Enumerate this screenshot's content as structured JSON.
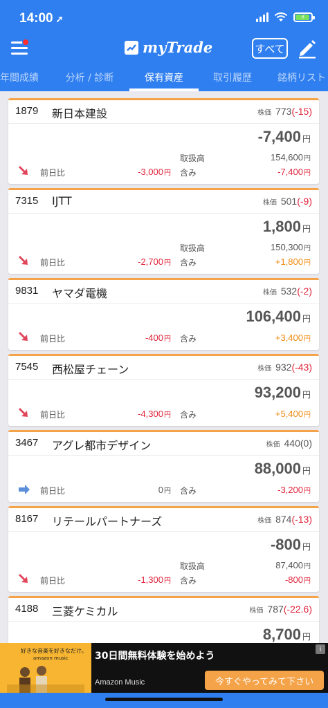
{
  "status": {
    "time": "14:00"
  },
  "header": {
    "logo": "myTrade",
    "all_button": "すべて"
  },
  "tabs": [
    {
      "label": "年間成績"
    },
    {
      "label": "分析 / 診断"
    },
    {
      "label": "保有資産"
    },
    {
      "label": "取引履歴"
    },
    {
      "label": "銘柄リスト"
    }
  ],
  "active_tab": 2,
  "labels": {
    "price": "株価",
    "day_change": "前日比",
    "turnover": "取扱高",
    "incl": "含み",
    "yen": "円"
  },
  "stocks": [
    {
      "code": "1879",
      "name": "新日本建設",
      "price": "773",
      "change": "(-15)",
      "change_type": "neg",
      "value": "-7,400",
      "day": "-3,000",
      "day_type": "neg",
      "arrow": "down",
      "turnover": "154,600",
      "unrealized": "-7,400",
      "unrealized_type": "neg"
    },
    {
      "code": "7315",
      "name": "IJTT",
      "price": "501",
      "change": "(-9)",
      "change_type": "neg",
      "value": "1,800",
      "day": "-2,700",
      "day_type": "neg",
      "arrow": "down",
      "turnover": "150,300",
      "unrealized": "+1,800",
      "unrealized_type": "pos"
    },
    {
      "code": "9831",
      "name": "ヤマダ電機",
      "price": "532",
      "change": "(-2)",
      "change_type": "neg",
      "value": "106,400",
      "day": "-400",
      "day_type": "neg",
      "arrow": "down",
      "turnover": null,
      "unrealized": "+3,400",
      "unrealized_type": "pos"
    },
    {
      "code": "7545",
      "name": "西松屋チェーン",
      "price": "932",
      "change": "(-43)",
      "change_type": "neg",
      "value": "93,200",
      "day": "-4,300",
      "day_type": "neg",
      "arrow": "down",
      "turnover": null,
      "unrealized": "+5,400",
      "unrealized_type": "pos"
    },
    {
      "code": "3467",
      "name": "アグレ都市デザイン",
      "price": "440",
      "change": "(0)",
      "change_type": "zero",
      "value": "88,000",
      "day": "0",
      "day_type": "gray",
      "arrow": "flat",
      "turnover": null,
      "unrealized": "-3,200",
      "unrealized_type": "neg"
    },
    {
      "code": "8167",
      "name": "リテールパートナーズ",
      "price": "874",
      "change": "(-13)",
      "change_type": "neg",
      "value": "-800",
      "day": "-1,300",
      "day_type": "neg",
      "arrow": "down",
      "turnover": "87,400",
      "unrealized": "-800",
      "unrealized_type": "neg"
    },
    {
      "code": "4188",
      "name": "三菱ケミカル",
      "price": "787",
      "change": "(-22.6)",
      "change_type": "neg",
      "value": "8,700",
      "day": "",
      "day_type": "neg",
      "arrow": "down",
      "turnover": null,
      "unrealized": "",
      "unrealized_type": "neg"
    }
  ],
  "ad": {
    "image_tagline": "好きな音楽を好きなだけ。",
    "image_brand": "amazon music",
    "title": "30日間無料体験を始めよう",
    "sponsor": "Amazon Music",
    "cta": "今すぐやってみて下さい",
    "info": "i"
  },
  "colors": {
    "header": "#2f7ff0",
    "card_accent": "#f5a348",
    "negative": "#e0243a",
    "positive": "#f08a10"
  }
}
